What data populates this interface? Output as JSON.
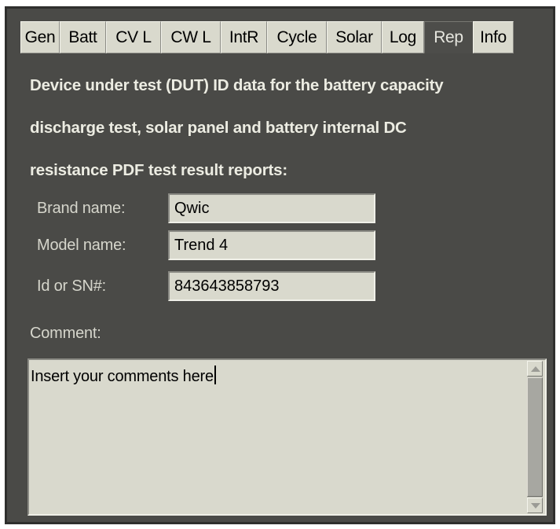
{
  "tabs": [
    {
      "label": "Gen",
      "active": false
    },
    {
      "label": "Batt",
      "active": false
    },
    {
      "label": "CV L",
      "active": false
    },
    {
      "label": "CW L",
      "active": false
    },
    {
      "label": "IntR",
      "active": false
    },
    {
      "label": "Cycle",
      "active": false
    },
    {
      "label": "Solar",
      "active": false
    },
    {
      "label": "Log",
      "active": false
    },
    {
      "label": "Rep",
      "active": true
    },
    {
      "label": "Info",
      "active": false
    }
  ],
  "report": {
    "heading_line1": "Device under test (DUT) ID data for the battery capacity",
    "heading_line2": "discharge test, solar panel and battery internal DC",
    "heading_line3": "resistance PDF test result reports:",
    "brand_label": "Brand name:",
    "brand_value": "Qwic",
    "model_label": "Model name:",
    "model_value": "Trend 4",
    "id_label": "Id or SN#:",
    "id_value": "843643858793",
    "comment_label": "Comment:",
    "comment_text": "Insert your comments here"
  },
  "colors": {
    "panel_bg": "#4a4a47",
    "field_bg": "#d9d9cd",
    "heading_text": "#ecece2",
    "label_text": "#d6d6cc"
  },
  "icons": {
    "scroll_up": "triangle-up-icon",
    "scroll_down": "triangle-down-icon"
  }
}
